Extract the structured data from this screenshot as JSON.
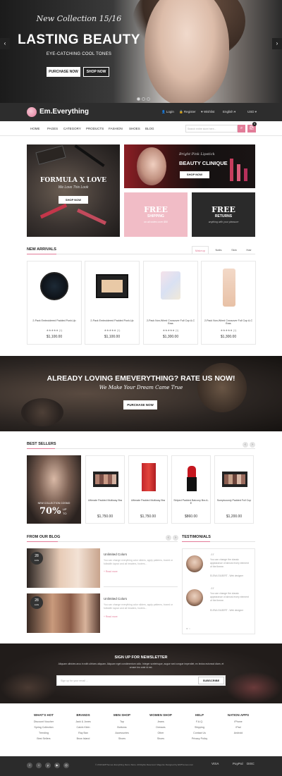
{
  "hero": {
    "italic": "New Collection 15/16",
    "title": "LASTING BEAUTY",
    "subtitle": "EYE-CATCHING COOL TONES",
    "btn_primary": "PURCHASE NOW",
    "btn_secondary": "SHOP NOW",
    "prev_icon": "‹",
    "next_icon": "›"
  },
  "topbar": {
    "logo": "Em.Everything",
    "login": "Login",
    "register": "Register",
    "wishlist": "Wishlist",
    "language": "English ▾",
    "currency": "USD ▾"
  },
  "nav": {
    "items": [
      "HOME",
      "PAGES",
      "CATEGORY",
      "PRODUCTS",
      "FASHION",
      "SHOES",
      "BLOG"
    ],
    "search_placeholder": "Search entire store here..."
  },
  "cart": {
    "count": "0"
  },
  "banners": {
    "b1_title": "FORMULA X LOVE",
    "b1_sub": "We Love This Look",
    "b1_btn": "SHOP NOW",
    "b2_italic": "Bright Pink Lipstick",
    "b2_title": "BEAUTY CLINIQUE",
    "b2_btn": "SHOP NOW",
    "b3_title": "FREE",
    "b3_sub": "SHIPPING",
    "b3_note": "on all orders over $50",
    "b4_title": "FREE",
    "b4_sub": "RETURNS",
    "b4_note": "anything with your pleasure"
  },
  "new_arrivals": {
    "heading": "NEW ARRIVALS",
    "tabs": [
      "Makeup",
      "Nails",
      "Skin",
      "Hair"
    ],
    "products": [
      {
        "name": "2-Pack Embroidered Padded Push-Up",
        "stars": "★★★★★ (1)",
        "price": "$1,100.00"
      },
      {
        "name": "2-Pack Embroidered Padded Push-Up",
        "stars": "★★★★★ (1)",
        "price": "$1,100.00"
      },
      {
        "name": "2-Pack Non-Wired Crossover Full Cup A-C Bras",
        "stars": "★★★★★ (1)",
        "price": "$1,300.00"
      },
      {
        "name": "2-Pack Non-Wired Crossover Full Cup A-C Bras",
        "stars": "★★★★★ (1)",
        "price": "$1,300.00"
      }
    ]
  },
  "rate": {
    "title": "ALREADY LOVING EMEVERYTHING? RATE US NOW!",
    "sub": "We Make Your Dream Came True",
    "btn": "PURCHASE NOW"
  },
  "best_sellers": {
    "heading": "BEST SELLERS",
    "promo_label": "NEW COLLECTION COSMO",
    "promo_pct": "70%",
    "promo_up": "UP",
    "promo_to": "TO",
    "products": [
      {
        "name": "Ultimate Padded Multiway Bra",
        "price": "$1,750.00"
      },
      {
        "name": "Ultimate Padded Multiway Bra",
        "price": "$1,750.00"
      },
      {
        "name": "Striped Padded Balcony Bra A-E",
        "price": "$860.00"
      },
      {
        "name": "Sumptuously Padded Full Cup",
        "price": "$1,200.00"
      }
    ]
  },
  "blog": {
    "heading": "FROM OUR BLOG",
    "posts": [
      {
        "day": "28",
        "month": "AUG",
        "title": "Unlimited Colors",
        "text": "You can change everything color sliders, apply patterns, boxed or fullwidth layout and all headers, footers...",
        "more": "+ Read more"
      },
      {
        "day": "28",
        "month": "AUG",
        "title": "Unlimited Colors",
        "text": "You can change everything color sliders, apply patterns, boxed or fullwidth layout and all headers, footers...",
        "more": "+ Read more"
      }
    ]
  },
  "testimonials": {
    "heading": "TESTIMONIALS",
    "items": [
      {
        "text": "You can change the classic appearance of almost every element of the theme.",
        "name": "ELENA GILBERT - Web designer"
      },
      {
        "text": "You can change the classic appearance of almost every element of the theme.",
        "name": "ELENA GILBERT - Web designer"
      }
    ]
  },
  "newsletter": {
    "title": "SIGN UP FOR NEWSLETTER",
    "text": "Aliquam ultricies arcu in with ultrices aliquam. Aliquam eget condimentum odio. Integer scelerisque, augue sed congue imperdiet, ex lectus euismod diam, et ornare leo ante id est.",
    "placeholder": "Sign up for your email ...",
    "btn": "SUBSCRIBE"
  },
  "footer": {
    "cols": [
      {
        "title": "WHAT'S HOT",
        "items": [
          "Discount Voucher",
          "Spring Collection",
          "Trending",
          "Best Sellers"
        ]
      },
      {
        "title": "BRANDS",
        "items": [
          "Jack & Jones",
          "Calvin Klein",
          "Ray Ban",
          "Brow Island"
        ]
      },
      {
        "title": "MEN SHOP",
        "items": [
          "Top",
          "Bottoms",
          "Accessories",
          "Shoes"
        ]
      },
      {
        "title": "WOMEN SHOP",
        "items": [
          "Jeans",
          "Dresses",
          "Other",
          "Shoes"
        ]
      },
      {
        "title": "HELP",
        "items": [
          "F.A.Q.",
          "Shipping",
          "Contact Us",
          "Privacy Policy"
        ]
      },
      {
        "title": "NATION APPS",
        "items": [
          "iPhone",
          "iPad",
          "Android"
        ]
      }
    ],
    "copyright": "© 2016 EMThemes Everything Demo Store. All Rights Reserved. Magento Designed by EMThemes.com",
    "payments": [
      "VISA",
      "PayPal",
      "DISC"
    ]
  },
  "colors": {
    "accent": "#e27c98",
    "dark": "#2d2d2d"
  }
}
